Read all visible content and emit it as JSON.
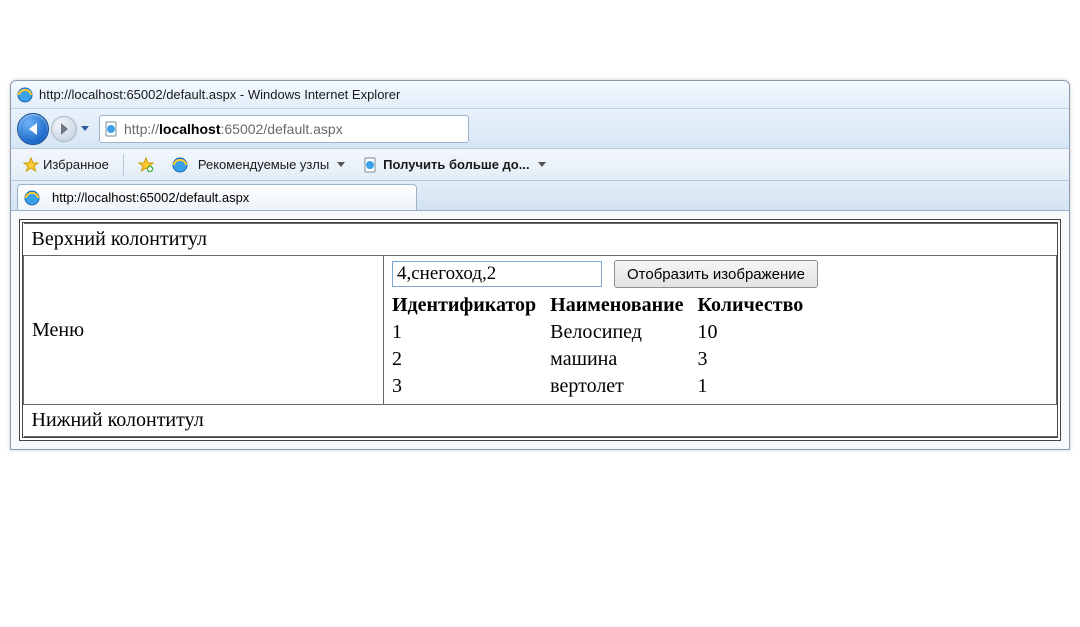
{
  "window": {
    "title": "http://localhost:65002/default.aspx - Windows Internet Explorer"
  },
  "addressbar": {
    "url_display_prefix": "http://",
    "url_display_bold": "localhost",
    "url_display_suffix": ":65002/default.aspx"
  },
  "favoritesbar": {
    "favorites_label": "Избранное",
    "suggested_sites_label": "Рекомендуемые узлы",
    "get_more_label": "Получить больше до..."
  },
  "tab": {
    "title": "http://localhost:65002/default.aspx"
  },
  "page": {
    "header_text": "Верхний колонтитул",
    "menu_label": "Меню",
    "footer_text": "Нижний колонтитул",
    "input_value": "4,снегоход,2",
    "button_label": "Отобразить изображение",
    "grid": {
      "columns": [
        "Идентификатор",
        "Наименование",
        "Количество"
      ],
      "rows": [
        {
          "id": "1",
          "name": "Велосипед",
          "qty": "10"
        },
        {
          "id": "2",
          "name": "машина",
          "qty": "3"
        },
        {
          "id": "3",
          "name": "вертолет",
          "qty": "1"
        }
      ]
    }
  }
}
